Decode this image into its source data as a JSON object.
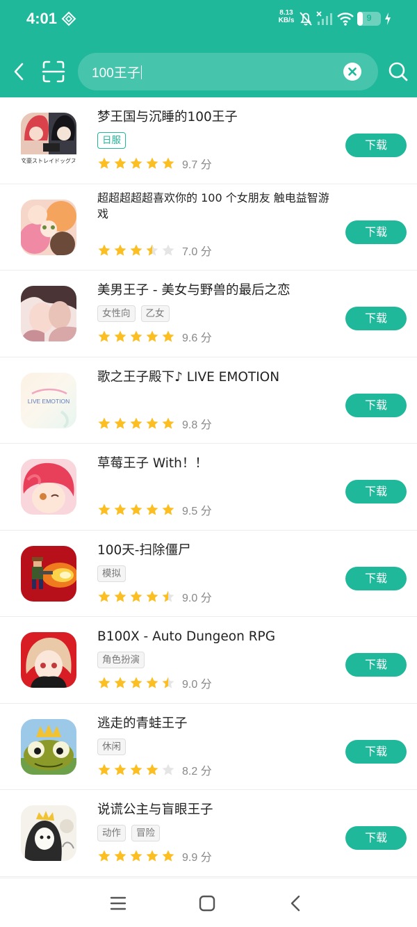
{
  "status_bar": {
    "time": "4:01",
    "net_speed_value": "8.13",
    "net_speed_unit": "KB/s",
    "battery": "9",
    "battery_level": 0.09,
    "icons": [
      "app-icon",
      "mute-icon",
      "no-signal-icon",
      "wifi-icon",
      "battery-icon",
      "charging-icon"
    ]
  },
  "search": {
    "query": "100王子",
    "icons": [
      "back-icon",
      "scan-icon",
      "clear-icon",
      "search-icon"
    ]
  },
  "colors": {
    "brand": "#1fb89a",
    "star": "#fbbf24",
    "star_empty": "#e5e5e5"
  },
  "results": [
    {
      "title": "梦王国与沉睡的100王子",
      "tags": [
        "日服"
      ],
      "tag_style": "green",
      "stars": 5,
      "score": "9.7 分",
      "button": "下载"
    },
    {
      "title": "超超超超超喜欢你的 100 个女朋友 触电益智游戏",
      "tags": [],
      "stars": 3.5,
      "score": "7.0 分",
      "button": "下载"
    },
    {
      "title": "美男王子 - 美女与野兽的最后之恋",
      "tags": [
        "女性向",
        "乙女"
      ],
      "stars": 5,
      "score": "9.6 分",
      "button": "下载"
    },
    {
      "title": "歌之王子殿下♪ LIVE EMOTION",
      "tags": [],
      "stars": 5,
      "score": "9.8 分",
      "button": "下载"
    },
    {
      "title": "草莓王子 With！！",
      "tags": [],
      "stars": 5,
      "score": "9.5 分",
      "button": "下载"
    },
    {
      "title": "100天-扫除僵尸",
      "tags": [
        "模拟"
      ],
      "stars": 4.5,
      "score": "9.0 分",
      "button": "下载"
    },
    {
      "title": "B100X - Auto Dungeon RPG",
      "tags": [
        "角色扮演"
      ],
      "stars": 4.5,
      "score": "9.0 分",
      "button": "下载"
    },
    {
      "title": "逃走的青蛙王子",
      "tags": [
        "休闲"
      ],
      "stars": 4,
      "score": "8.2 分",
      "button": "下载"
    },
    {
      "title": "说谎公主与盲眼王子",
      "tags": [
        "动作",
        "冒险"
      ],
      "stars": 5,
      "score": "9.9 分",
      "button": "下载"
    }
  ],
  "app_icon_logo_text": {
    "item0": "文豪ストレイドッグス",
    "item3": "LIVE EMOTION"
  },
  "navbar": {
    "icons": [
      "menu-icon",
      "home-icon",
      "back-nav-icon"
    ]
  }
}
